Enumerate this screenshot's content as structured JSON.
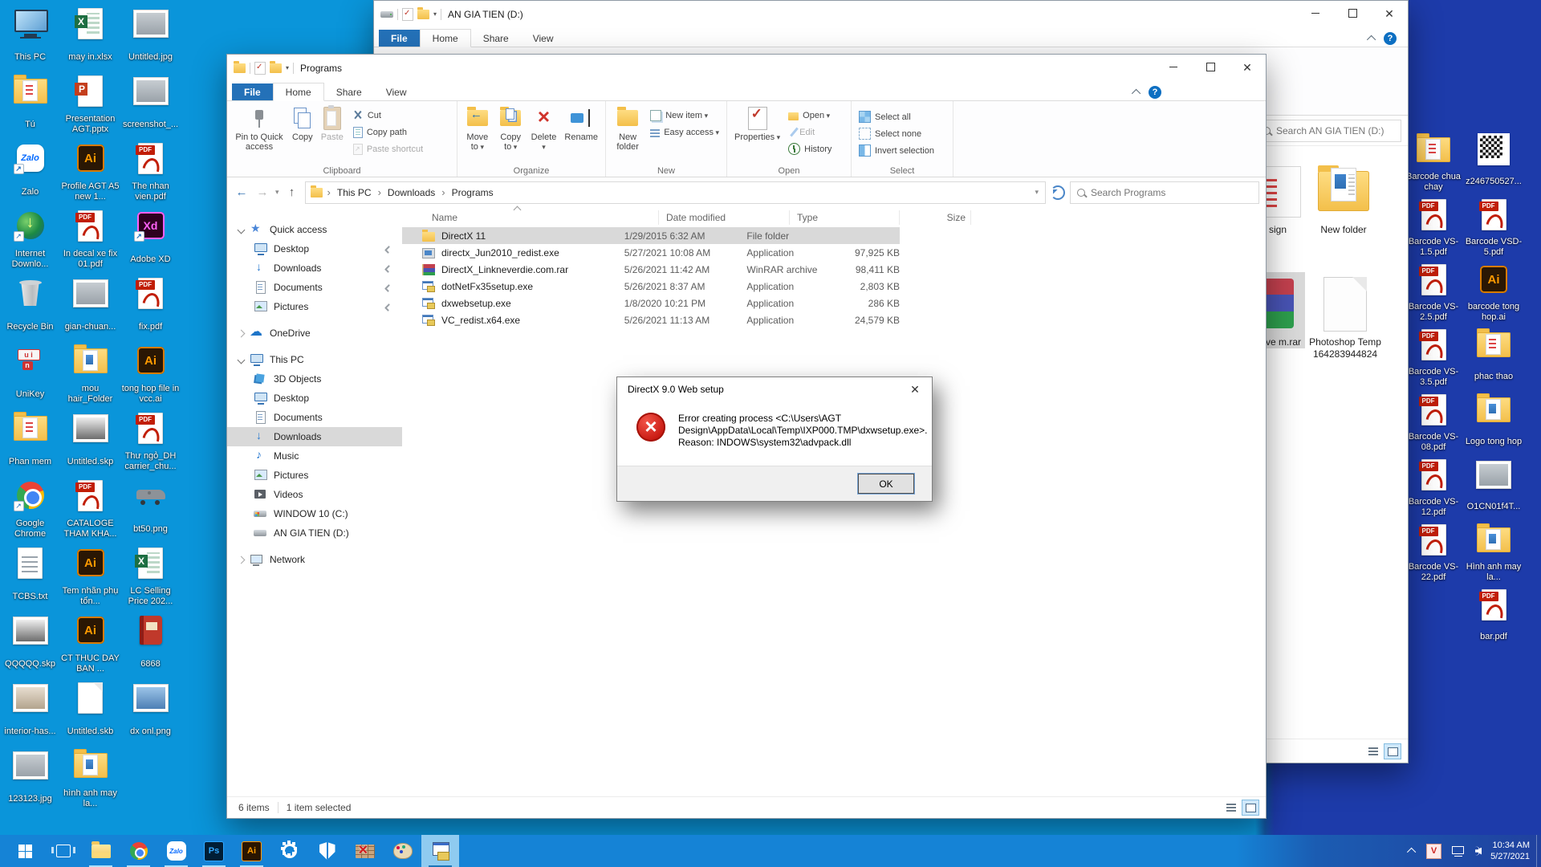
{
  "colors": {
    "desktop_blue": "#0a95da",
    "desktop_navy": "#1d3baa",
    "taskbar": "#1583d6",
    "accent_tab": "#2471b8",
    "selection_gray": "#d9d9d9",
    "error_red": "#c81a12",
    "help_blue": "#0d6fc2"
  },
  "desktop": {
    "left_icons": [
      {
        "label": "This PC",
        "type": "computer-icon"
      },
      {
        "label": "may in.xlsx",
        "type": "excel-file-icon"
      },
      {
        "label": "Untitled.jpg",
        "type": "image-file-icon"
      },
      {
        "label": "Tú",
        "type": "folder-icon"
      },
      {
        "label": "Presentation AGT.pptx",
        "type": "powerpoint-file-icon"
      },
      {
        "label": "screenshot_...",
        "type": "image-file-icon"
      },
      {
        "label": "Zalo",
        "type": "zalo-shortcut-icon"
      },
      {
        "label": "Profile AGT A5 new 1...",
        "type": "illustrator-file-icon"
      },
      {
        "label": "The nhan vien.pdf",
        "type": "pdf-file-icon"
      },
      {
        "label": "Internet Downlo...",
        "type": "idm-shortcut-icon"
      },
      {
        "label": "In decal xe fix 01.pdf",
        "type": "pdf-file-icon"
      },
      {
        "label": "Adobe XD",
        "type": "adobe-xd-shortcut-icon"
      },
      {
        "label": "Recycle Bin",
        "type": "recycle-bin-icon"
      },
      {
        "label": "gian-chuan...",
        "type": "image-file-icon"
      },
      {
        "label": "fix.pdf",
        "type": "pdf-file-icon"
      },
      {
        "label": "UniKey",
        "type": "unikey-shortcut-icon"
      },
      {
        "label": "mou hair_Folder",
        "type": "folder-icon"
      },
      {
        "label": "tong hop file in vcc.ai",
        "type": "illustrator-file-icon"
      },
      {
        "label": "Phan mem",
        "type": "folder-icon"
      },
      {
        "label": "Untitled.skp",
        "type": "sketchup-file-icon"
      },
      {
        "label": "Thư ngỏ_DH carrier_chu...",
        "type": "pdf-file-icon"
      },
      {
        "label": "Google Chrome",
        "type": "chrome-shortcut-icon"
      },
      {
        "label": "CATALOGE THAM KHA...",
        "type": "pdf-file-icon"
      },
      {
        "label": "bt50.png",
        "type": "image-file-icon"
      },
      {
        "label": "TCBS.txt",
        "type": "text-file-icon"
      },
      {
        "label": "Tem nhãn phụ tổn...",
        "type": "illustrator-file-icon"
      },
      {
        "label": "LC Selling Price 202...",
        "type": "excel-file-icon"
      },
      {
        "label": "QQQQQ.skp",
        "type": "sketchup-file-icon"
      },
      {
        "label": "CT THUC DAY BAN ...",
        "type": "illustrator-file-icon"
      },
      {
        "label": "6868",
        "type": "book-icon"
      },
      {
        "label": "interior-has...",
        "type": "image-file-icon"
      },
      {
        "label": "Untitled.skb",
        "type": "blank-file-icon"
      },
      {
        "label": "dx onl.png",
        "type": "image-file-icon"
      },
      {
        "label": "123123.jpg",
        "type": "image-file-icon"
      },
      {
        "label": "hình anh may la...",
        "type": "folder-icon"
      }
    ],
    "right_col_a": [
      {
        "label": "Barcode chua chay",
        "type": "folder-icon"
      },
      {
        "label": "Barcode VS-1.5.pdf",
        "type": "pdf-file-icon"
      },
      {
        "label": "Barcode VS-2.5.pdf",
        "type": "pdf-file-icon"
      },
      {
        "label": "Barcode VS-3.5.pdf",
        "type": "pdf-file-icon"
      },
      {
        "label": "Barcode VS-08.pdf",
        "type": "pdf-file-icon"
      },
      {
        "label": "Barcode VS-12.pdf",
        "type": "pdf-file-icon"
      },
      {
        "label": "Barcode VS-22.pdf",
        "type": "pdf-file-icon"
      }
    ],
    "right_col_b": [
      {
        "label": "z246750527...",
        "type": "qr-image-icon"
      },
      {
        "label": "Barcode VSD-5.pdf",
        "type": "pdf-file-icon"
      },
      {
        "label": "barcode tong hop.ai",
        "type": "illustrator-file-icon"
      },
      {
        "label": "phac thao",
        "type": "folder-icon"
      },
      {
        "label": "Logo tong hop",
        "type": "folder-icon"
      },
      {
        "label": "O1CN01f4T...",
        "type": "image-file-icon"
      },
      {
        "label": "Hình anh may la...",
        "type": "folder-icon"
      },
      {
        "label": "bar.pdf",
        "type": "pdf-file-icon"
      }
    ]
  },
  "bg_window": {
    "title": "AN GIA TIEN (D:)",
    "tabs": [
      "File",
      "Home",
      "Share",
      "View"
    ],
    "search_placeholder": "Search AN GIA TIEN (D:)",
    "items": [
      {
        "label": "sign",
        "type": "folder-icon"
      },
      {
        "label": "New folder",
        "type": "folder-icon"
      },
      {
        "label": "nkneve m.rar",
        "type": "winrar-archive-icon",
        "selected": true
      },
      {
        "label": "Photoshop Temp164283944824",
        "type": "blank-file-icon"
      }
    ]
  },
  "explorer": {
    "title": "Programs",
    "tabs": [
      "File",
      "Home",
      "Share",
      "View"
    ],
    "ribbon": {
      "pin": "Pin to Quick access",
      "copy": "Copy",
      "paste": "Paste",
      "cut": "Cut",
      "copy_path": "Copy path",
      "paste_shortcut": "Paste shortcut",
      "clipboard": "Clipboard",
      "move_to": "Move to",
      "copy_to": "Copy to",
      "del": "Delete",
      "rename": "Rename",
      "organize": "Organize",
      "new_folder": "New folder",
      "new_item": "New item",
      "easy_access": "Easy access",
      "new_group": "New",
      "properties": "Properties",
      "open": "Open",
      "edit": "Edit",
      "history": "History",
      "open_group": "Open",
      "select_all": "Select all",
      "select_none": "Select none",
      "invert": "Invert selection",
      "select_group": "Select"
    },
    "address": {
      "crumbs": [
        "This PC",
        "Downloads",
        "Programs"
      ],
      "search_placeholder": "Search Programs"
    },
    "sidebar": {
      "items": [
        {
          "label": "Quick access"
        },
        {
          "label": "Desktop"
        },
        {
          "label": "Downloads"
        },
        {
          "label": "Documents"
        },
        {
          "label": "Pictures"
        },
        {
          "label": "OneDrive"
        },
        {
          "label": "This PC"
        },
        {
          "label": "3D Objects"
        },
        {
          "label": "Desktop"
        },
        {
          "label": "Documents"
        },
        {
          "label": "Downloads"
        },
        {
          "label": "Music"
        },
        {
          "label": "Pictures"
        },
        {
          "label": "Videos"
        },
        {
          "label": "WINDOW 10 (C:)"
        },
        {
          "label": "AN GIA TIEN (D:)"
        },
        {
          "label": "Network"
        }
      ]
    },
    "table": {
      "columns": [
        "Name",
        "Date modified",
        "Type",
        "Size"
      ],
      "rows": [
        {
          "name": "DirectX 11",
          "date": "1/29/2015 6:32 AM",
          "type": "File folder",
          "size": "",
          "icon": "folder-icon",
          "selected": true
        },
        {
          "name": "directx_Jun2010_redist.exe",
          "date": "5/27/2021 10:08 AM",
          "type": "Application",
          "size": "97,925 KB",
          "icon": "application-icon"
        },
        {
          "name": "DirectX_Linkneverdie.com.rar",
          "date": "5/26/2021 11:42 AM",
          "type": "WinRAR archive",
          "size": "98,411 KB",
          "icon": "winrar-archive-icon"
        },
        {
          "name": "dotNetFx35setup.exe",
          "date": "5/26/2021 8:37 AM",
          "type": "Application",
          "size": "2,803 KB",
          "icon": "installer-icon"
        },
        {
          "name": "dxwebsetup.exe",
          "date": "1/8/2020 10:21 PM",
          "type": "Application",
          "size": "286 KB",
          "icon": "installer-icon"
        },
        {
          "name": "VC_redist.x64.exe",
          "date": "5/26/2021 11:13 AM",
          "type": "Application",
          "size": "24,579 KB",
          "icon": "installer-icon"
        }
      ]
    },
    "status": {
      "items": "6 items",
      "selected": "1 item selected"
    }
  },
  "dialog": {
    "title": "DirectX 9.0 Web setup",
    "line1": "Error creating process <C:\\Users\\AGT",
    "line2": "Design\\AppData\\Local\\Temp\\IXP000.TMP\\dxwsetup.exe>.",
    "line3": "Reason: INDOWS\\system32\\advpack.dll",
    "ok": "OK"
  },
  "taskbar": {
    "icons": [
      "start",
      "task-view",
      "file-explorer",
      "chrome",
      "zalo",
      "photoshop",
      "illustrator",
      "settings",
      "windows-security",
      "firewall",
      "paint",
      "directx-setup"
    ],
    "tray": {
      "time": "10:34 AM",
      "date": "5/27/2021"
    }
  }
}
